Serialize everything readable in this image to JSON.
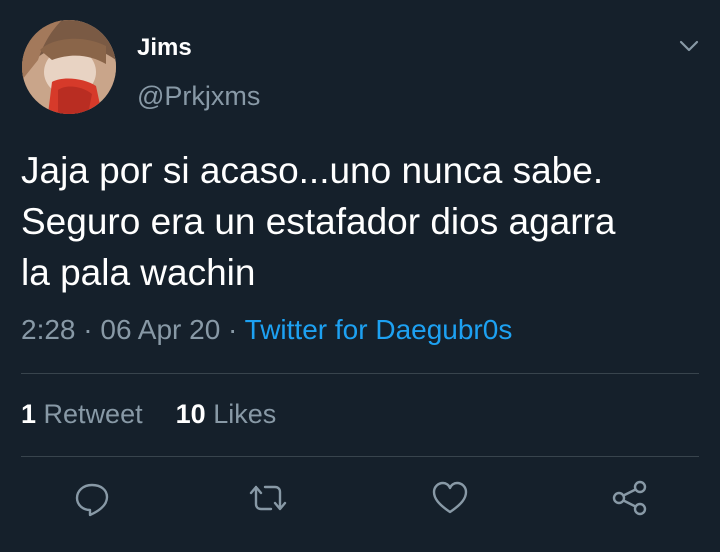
{
  "author": {
    "name": "Jims",
    "handle": "@Prkjxms",
    "avatar_icon": "profile-photo"
  },
  "tweet": {
    "text": "Jaja por si acaso...uno nunca sabe.\nSeguro era un estafador dios agarra\nla pala wachin",
    "time": "2:28",
    "separator": "·",
    "date": "06 Apr 20",
    "source": "Twitter for Daegubr0s"
  },
  "stats": {
    "retweets_count": "1",
    "retweets_label": "Retweet",
    "likes_count": "10",
    "likes_label": "Likes"
  },
  "actions": [
    "reply-icon",
    "retweet-icon",
    "like-icon",
    "share-icon"
  ],
  "colors": {
    "background": "#15202b",
    "primary_text": "#ffffff",
    "secondary_text": "#8899a6",
    "link": "#1da1f2",
    "divider": "#38444d"
  }
}
